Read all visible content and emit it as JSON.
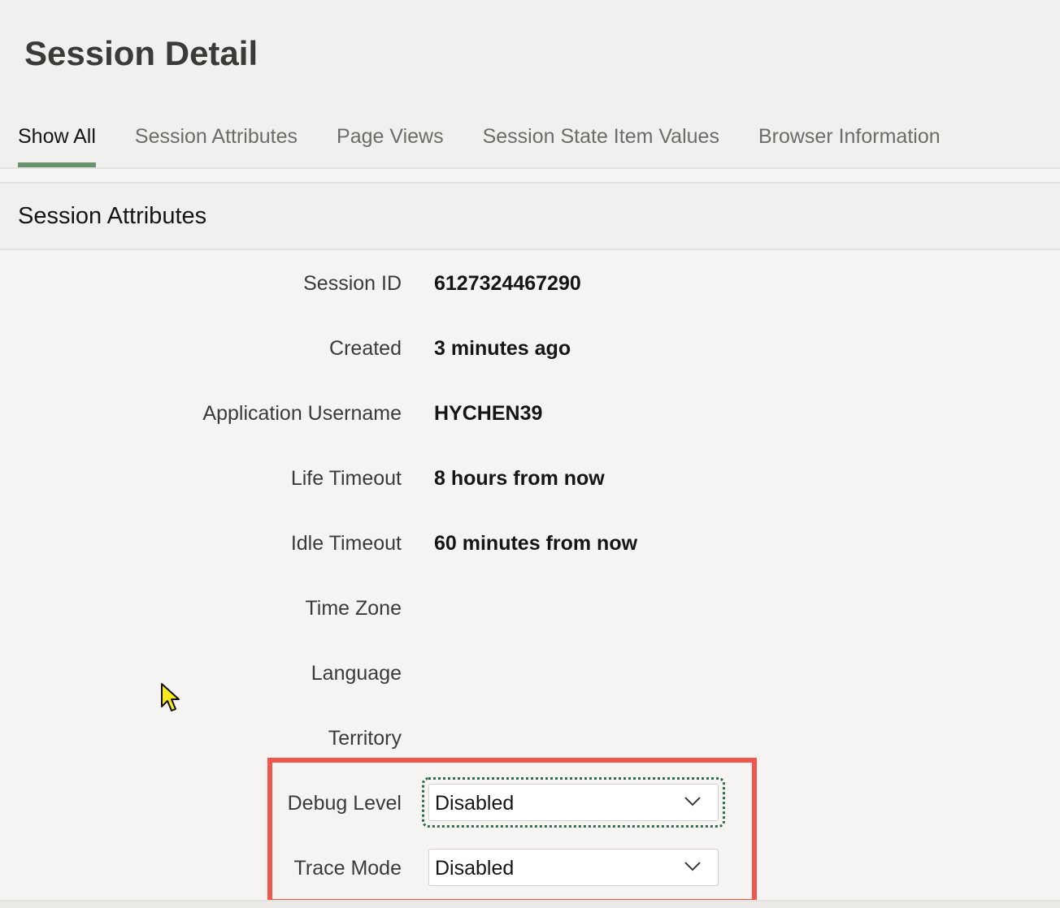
{
  "page": {
    "title": "Session Detail"
  },
  "tabs": [
    {
      "label": "Show All",
      "active": true
    },
    {
      "label": "Session Attributes",
      "active": false
    },
    {
      "label": "Page Views",
      "active": false
    },
    {
      "label": "Session State Item Values",
      "active": false
    },
    {
      "label": "Browser Information",
      "active": false
    }
  ],
  "region": {
    "title": "Session Attributes"
  },
  "fields": [
    {
      "label": "Session ID",
      "value": "6127324467290"
    },
    {
      "label": "Created",
      "value": "3 minutes ago"
    },
    {
      "label": "Application Username",
      "value": "HYCHEN39"
    },
    {
      "label": "Life Timeout",
      "value": "8 hours from now"
    },
    {
      "label": "Idle Timeout",
      "value": "60 minutes from now"
    },
    {
      "label": "Time Zone",
      "value": ""
    },
    {
      "label": "Language",
      "value": ""
    },
    {
      "label": "Territory",
      "value": ""
    }
  ],
  "selects": {
    "debug_level": {
      "label": "Debug Level",
      "value": "Disabled"
    },
    "trace_mode": {
      "label": "Trace Mode",
      "value": "Disabled"
    }
  },
  "icons": {
    "dropdown": "chevron-down-icon",
    "cursor": "mouse-pointer-icon"
  },
  "colors": {
    "active_tab_underline": "#6a9470",
    "highlight_border": "#f0574a",
    "focus_ring": "#2f6b46",
    "cursor_fill": "#f5e81e"
  }
}
